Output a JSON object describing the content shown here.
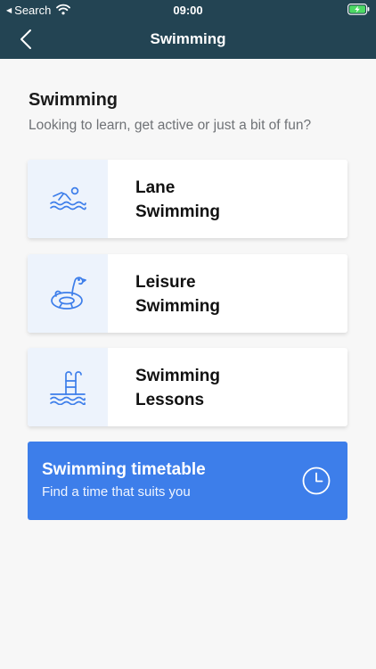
{
  "status_bar": {
    "back_app": "Search",
    "time": "09:00"
  },
  "nav": {
    "title": "Swimming"
  },
  "page": {
    "heading": "Swimming",
    "subheading": "Looking to learn, get active or just a bit of fun?"
  },
  "cards": [
    {
      "line1": "Lane",
      "line2": "Swimming",
      "icon": "swimmer-icon"
    },
    {
      "line1": "Leisure",
      "line2": "Swimming",
      "icon": "inflatable-flamingo-icon"
    },
    {
      "line1": "Swimming",
      "line2": "Lessons",
      "icon": "pool-ladder-icon"
    }
  ],
  "timetable": {
    "title": "Swimming timetable",
    "subtitle": "Find a time that suits you",
    "icon": "clock-icon"
  },
  "colors": {
    "header_bg": "#234453",
    "page_bg": "#f7f7f7",
    "icon_box_bg": "#edf3fc",
    "icon_stroke": "#3d7eea",
    "cta_bg": "#3d7eea",
    "battery_green": "#4cd964"
  }
}
